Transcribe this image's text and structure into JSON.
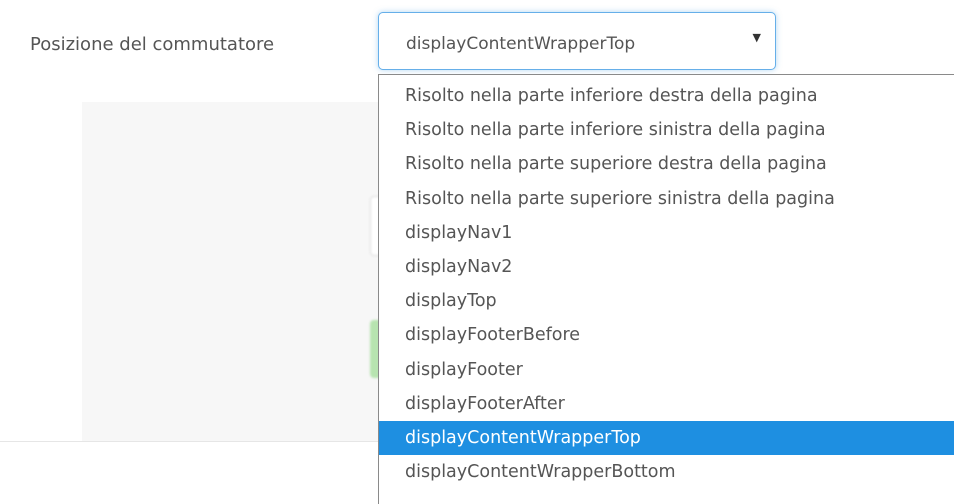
{
  "field": {
    "label": "Posizione del commutatore",
    "selected_value": "displayContentWrapperTop"
  },
  "dropdown": {
    "options": [
      "Risolto nella parte inferiore destra della pagina",
      "Risolto nella parte inferiore sinistra della pagina",
      "Risolto nella parte superiore destra della pagina",
      "Risolto nella parte superiore sinistra della pagina",
      "displayNav1",
      "displayNav2",
      "displayTop",
      "displayFooterBefore",
      "displayFooter",
      "displayFooterAfter",
      "displayContentWrapperTop",
      "displayContentWrapperBottom"
    ],
    "selected_index": 10
  },
  "icons": {
    "caret": "dropdown-caret-icon"
  }
}
